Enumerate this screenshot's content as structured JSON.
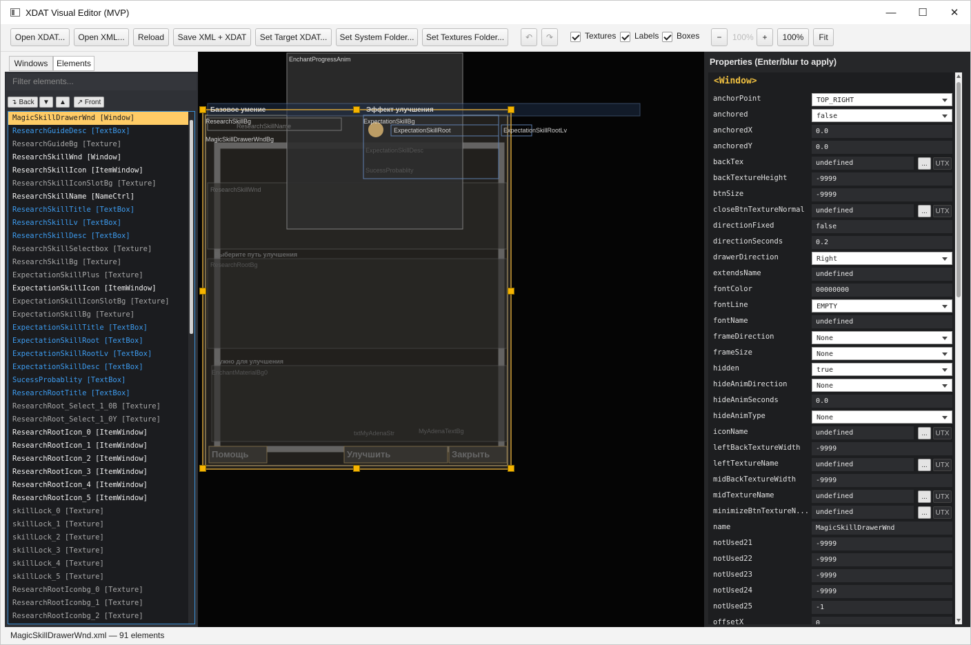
{
  "window": {
    "title": "XDAT Visual Editor (MVP)",
    "controls": {
      "minimize": "—",
      "maximize": "☐",
      "close": "✕"
    }
  },
  "toolbar": {
    "open_xdat": "Open XDAT...",
    "open_xml": "Open XML...",
    "reload": "Reload",
    "save": "Save XML + XDAT",
    "set_target": "Set Target XDAT...",
    "set_system": "Set System Folder...",
    "set_textures": "Set Textures Folder...",
    "undo": "↶",
    "redo": "↷",
    "textures_label": "Textures",
    "labels_label": "Labels",
    "boxes_label": "Boxes",
    "zoom_out": "−",
    "zoom_display": "100%",
    "zoom_in": "+",
    "zoom_100": "100%",
    "fit": "Fit"
  },
  "left": {
    "tabs": [
      "Windows",
      "Elements"
    ],
    "filter_placeholder": "Filter elements...",
    "nav": {
      "back": "↴ Back",
      "down": "▼",
      "up": "▲",
      "front": "↗ Front"
    },
    "items": [
      {
        "name": "MagicSkillDrawerWnd",
        "type": "[Window]",
        "kind": "sel"
      },
      {
        "name": "ResearchGuideDesc",
        "type": "[TextBox]",
        "kind": "b"
      },
      {
        "name": "ResearchGuideBg",
        "type": "[Texture]",
        "kind": "t"
      },
      {
        "name": "ResearchSkillWnd",
        "type": "[Window]",
        "kind": "w"
      },
      {
        "name": "ResearchSkillIcon",
        "type": "[ItemWindow]",
        "kind": "w"
      },
      {
        "name": "ResearchSkillIconSlotBg",
        "type": "[Texture]",
        "kind": "t"
      },
      {
        "name": "ResearchSkillName",
        "type": "[NameCtrl]",
        "kind": "w"
      },
      {
        "name": "ResearchSkillTitle",
        "type": "[TextBox]",
        "kind": "b"
      },
      {
        "name": "ResearchSkillLv",
        "type": "[TextBox]",
        "kind": "b"
      },
      {
        "name": "ResearchSkillDesc",
        "type": "[TextBox]",
        "kind": "b"
      },
      {
        "name": "ResearchSkillSelectbox",
        "type": "[Texture]",
        "kind": "t"
      },
      {
        "name": "ResearchSkillBg",
        "type": "[Texture]",
        "kind": "t"
      },
      {
        "name": "ExpectationSkillPlus",
        "type": "[Texture]",
        "kind": "t"
      },
      {
        "name": "ExpectationSkillIcon",
        "type": "[ItemWindow]",
        "kind": "w"
      },
      {
        "name": "ExpectationSkillIconSlotBg",
        "type": "[Texture]",
        "kind": "t"
      },
      {
        "name": "ExpectationSkillBg",
        "type": "[Texture]",
        "kind": "t"
      },
      {
        "name": "ExpectationSkillTitle",
        "type": "[TextBox]",
        "kind": "b"
      },
      {
        "name": "ExpectationSkillRoot",
        "type": "[TextBox]",
        "kind": "b"
      },
      {
        "name": "ExpectationSkillRootLv",
        "type": "[TextBox]",
        "kind": "b"
      },
      {
        "name": "ExpectationSkillDesc",
        "type": "[TextBox]",
        "kind": "b"
      },
      {
        "name": "SucessProbablity",
        "type": "[TextBox]",
        "kind": "b"
      },
      {
        "name": "ResearchRootTitle",
        "type": "[TextBox]",
        "kind": "b"
      },
      {
        "name": "ResearchRoot_Select_1_0B",
        "type": "[Texture]",
        "kind": "t"
      },
      {
        "name": "ResearchRoot_Select_1_0Y",
        "type": "[Texture]",
        "kind": "t"
      },
      {
        "name": "ResearchRootIcon_0",
        "type": "[ItemWindow]",
        "kind": "w"
      },
      {
        "name": "ResearchRootIcon_1",
        "type": "[ItemWindow]",
        "kind": "w"
      },
      {
        "name": "ResearchRootIcon_2",
        "type": "[ItemWindow]",
        "kind": "w"
      },
      {
        "name": "ResearchRootIcon_3",
        "type": "[ItemWindow]",
        "kind": "w"
      },
      {
        "name": "ResearchRootIcon_4",
        "type": "[ItemWindow]",
        "kind": "w"
      },
      {
        "name": "ResearchRootIcon_5",
        "type": "[ItemWindow]",
        "kind": "w"
      },
      {
        "name": "skillLock_0",
        "type": "[Texture]",
        "kind": "t"
      },
      {
        "name": "skillLock_1",
        "type": "[Texture]",
        "kind": "t"
      },
      {
        "name": "skillLock_2",
        "type": "[Texture]",
        "kind": "t"
      },
      {
        "name": "skillLock_3",
        "type": "[Texture]",
        "kind": "t"
      },
      {
        "name": "skillLock_4",
        "type": "[Texture]",
        "kind": "t"
      },
      {
        "name": "skillLock_5",
        "type": "[Texture]",
        "kind": "t"
      },
      {
        "name": "ResearchRootIconbg_0",
        "type": "[Texture]",
        "kind": "t"
      },
      {
        "name": "ResearchRootIconbg_1",
        "type": "[Texture]",
        "kind": "t"
      },
      {
        "name": "ResearchRootIconbg_2",
        "type": "[Texture]",
        "kind": "t"
      }
    ]
  },
  "canvas": {
    "labels": {
      "enchant": "EnchantProgressAnim",
      "base_skill": "Базовое умение",
      "upgrade_effect": "Эффект улучшения",
      "research_bg": "ResearchSkillBg",
      "research_name": "ResearchSkillName",
      "exp_bg": "ExpectationSkillBg",
      "exp_root": "ExpectationSkillRoot",
      "exp_root_lv": "ExpectationSkillRootLv",
      "drawer_bg": "MagicSkillDrawerWndBg",
      "exp_desc": "ExpectationSkillDesc",
      "success": "SucessProbablity",
      "research_wnd": "ResearchSkillWnd",
      "choose_path": "Выберите путь улучшения",
      "root_bg": "ResearchRootBg",
      "need_upgrade": "Нужно для улучшения",
      "enchant_mat": "EnchantMaterialBg0",
      "adena_str": "txtMyAdenaStr",
      "adena_bg": "MyAdenaTextBg",
      "help": "Помощь",
      "upgrade": "Улучшить",
      "close": "Закрыть"
    }
  },
  "properties": {
    "title": "Properties (Enter/blur to apply)",
    "window_tag": "<Window>",
    "rows": [
      {
        "name": "anchorPoint",
        "value": "TOP_RIGHT",
        "kind": "select"
      },
      {
        "name": "anchored",
        "value": "false",
        "kind": "select"
      },
      {
        "name": "anchoredX",
        "value": "0.0",
        "kind": "text"
      },
      {
        "name": "anchoredY",
        "value": "0.0",
        "kind": "text"
      },
      {
        "name": "backTex",
        "value": "undefined",
        "kind": "tex"
      },
      {
        "name": "backTextureHeight",
        "value": "-9999",
        "kind": "text"
      },
      {
        "name": "btnSize",
        "value": "-9999",
        "kind": "text"
      },
      {
        "name": "closeBtnTextureNormal",
        "value": "undefined",
        "kind": "tex"
      },
      {
        "name": "directionFixed",
        "value": "false",
        "kind": "text"
      },
      {
        "name": "directionSeconds",
        "value": "0.2",
        "kind": "text"
      },
      {
        "name": "drawerDirection",
        "value": "Right",
        "kind": "select"
      },
      {
        "name": "extendsName",
        "value": "undefined",
        "kind": "text"
      },
      {
        "name": "fontColor",
        "value": "00000000",
        "kind": "text"
      },
      {
        "name": "fontLine",
        "value": "EMPTY",
        "kind": "select"
      },
      {
        "name": "fontName",
        "value": "undefined",
        "kind": "text"
      },
      {
        "name": "frameDirection",
        "value": "None",
        "kind": "select"
      },
      {
        "name": "frameSize",
        "value": "None",
        "kind": "select"
      },
      {
        "name": "hidden",
        "value": "true",
        "kind": "select"
      },
      {
        "name": "hideAnimDirection",
        "value": "None",
        "kind": "select"
      },
      {
        "name": "hideAnimSeconds",
        "value": "0.0",
        "kind": "text"
      },
      {
        "name": "hideAnimType",
        "value": "None",
        "kind": "select"
      },
      {
        "name": "iconName",
        "value": "undefined",
        "kind": "tex"
      },
      {
        "name": "leftBackTextureWidth",
        "value": "-9999",
        "kind": "text"
      },
      {
        "name": "leftTextureName",
        "value": "undefined",
        "kind": "tex"
      },
      {
        "name": "midBackTextureWidth",
        "value": "-9999",
        "kind": "text"
      },
      {
        "name": "midTextureName",
        "value": "undefined",
        "kind": "tex"
      },
      {
        "name": "minimizeBtnTextureN...",
        "value": "undefined",
        "kind": "tex"
      },
      {
        "name": "name",
        "value": "MagicSkillDrawerWnd",
        "kind": "text"
      },
      {
        "name": "notUsed21",
        "value": "-9999",
        "kind": "text"
      },
      {
        "name": "notUsed22",
        "value": "-9999",
        "kind": "text"
      },
      {
        "name": "notUsed23",
        "value": "-9999",
        "kind": "text"
      },
      {
        "name": "notUsed24",
        "value": "-9999",
        "kind": "text"
      },
      {
        "name": "notUsed25",
        "value": "-1",
        "kind": "text"
      },
      {
        "name": "offsetX",
        "value": "0",
        "kind": "text"
      }
    ],
    "dots_label": "...",
    "utx_label": "UTX"
  },
  "status": {
    "text": "MagicSkillDrawerWnd.xml — 91 elements"
  }
}
